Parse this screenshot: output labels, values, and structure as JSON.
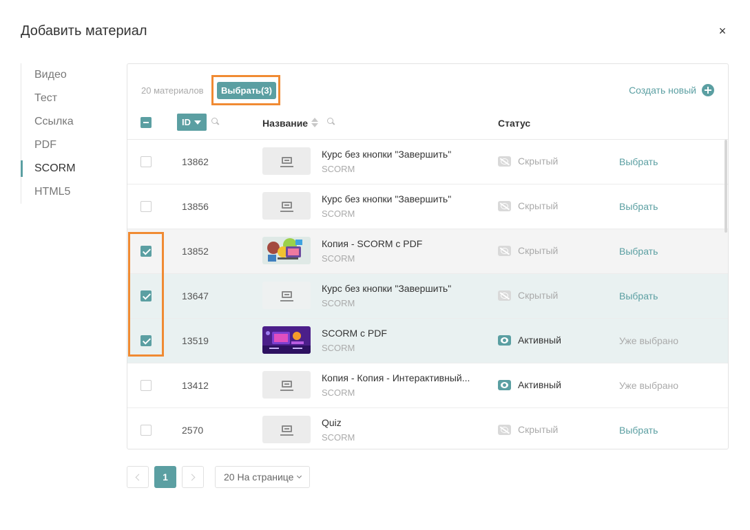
{
  "modal": {
    "title": "Добавить материал",
    "close_glyph": "×"
  },
  "sidebar": {
    "items": [
      {
        "label": "Видео",
        "active": false
      },
      {
        "label": "Тест",
        "active": false
      },
      {
        "label": "Ссылка",
        "active": false
      },
      {
        "label": "PDF",
        "active": false
      },
      {
        "label": "SCORM",
        "active": true
      },
      {
        "label": "HTML5",
        "active": false
      }
    ]
  },
  "toolbar": {
    "count_label": "20 материалов",
    "select_label": "Выбрать(3)",
    "create_label": "Создать новый"
  },
  "table": {
    "headers": {
      "id": "ID",
      "name": "Название",
      "status": "Статус"
    },
    "rows": [
      {
        "checked": false,
        "id": "13862",
        "title": "Курс без кнопки \"Завершить\"",
        "type": "SCORM",
        "status": "Скрытый",
        "status_kind": "hidden",
        "action": "Выбрать",
        "action_kind": "select",
        "thumb": "placeholder",
        "bg": "none"
      },
      {
        "checked": false,
        "id": "13856",
        "title": "Курс без кнопки \"Завершить\"",
        "type": "SCORM",
        "status": "Скрытый",
        "status_kind": "hidden",
        "action": "Выбрать",
        "action_kind": "select",
        "thumb": "placeholder",
        "bg": "none"
      },
      {
        "checked": true,
        "id": "13852",
        "title": "Копия - SCORM с PDF",
        "type": "SCORM",
        "status": "Скрытый",
        "status_kind": "hidden",
        "action": "Выбрать",
        "action_kind": "select",
        "thumb": "illustration-colorful",
        "bg": "grey"
      },
      {
        "checked": true,
        "id": "13647",
        "title": "Курс без кнопки \"Завершить\"",
        "type": "SCORM",
        "status": "Скрытый",
        "status_kind": "hidden",
        "action": "Выбрать",
        "action_kind": "select",
        "thumb": "placeholder",
        "bg": "teal"
      },
      {
        "checked": true,
        "id": "13519",
        "title": "SCORM с PDF",
        "type": "SCORM",
        "status": "Активный",
        "status_kind": "active",
        "action": "Уже выбрано",
        "action_kind": "done",
        "thumb": "illustration-purple",
        "bg": "teal"
      },
      {
        "checked": false,
        "id": "13412",
        "title": "Копия - Копия - Интерактивный...",
        "type": "SCORM",
        "status": "Активный",
        "status_kind": "active",
        "action": "Уже выбрано",
        "action_kind": "done",
        "thumb": "placeholder",
        "bg": "none"
      },
      {
        "checked": false,
        "id": "2570",
        "title": "Quiz",
        "type": "SCORM",
        "status": "Скрытый",
        "status_kind": "hidden",
        "action": "Выбрать",
        "action_kind": "select",
        "thumb": "placeholder",
        "bg": "none"
      }
    ]
  },
  "pagination": {
    "current_page": "1",
    "per_page_label": "20 На странице"
  },
  "colors": {
    "accent": "#5b9fa2",
    "highlight": "#f08a32",
    "row_grey": "#f4f4f4",
    "row_teal": "#e9f1f1"
  }
}
